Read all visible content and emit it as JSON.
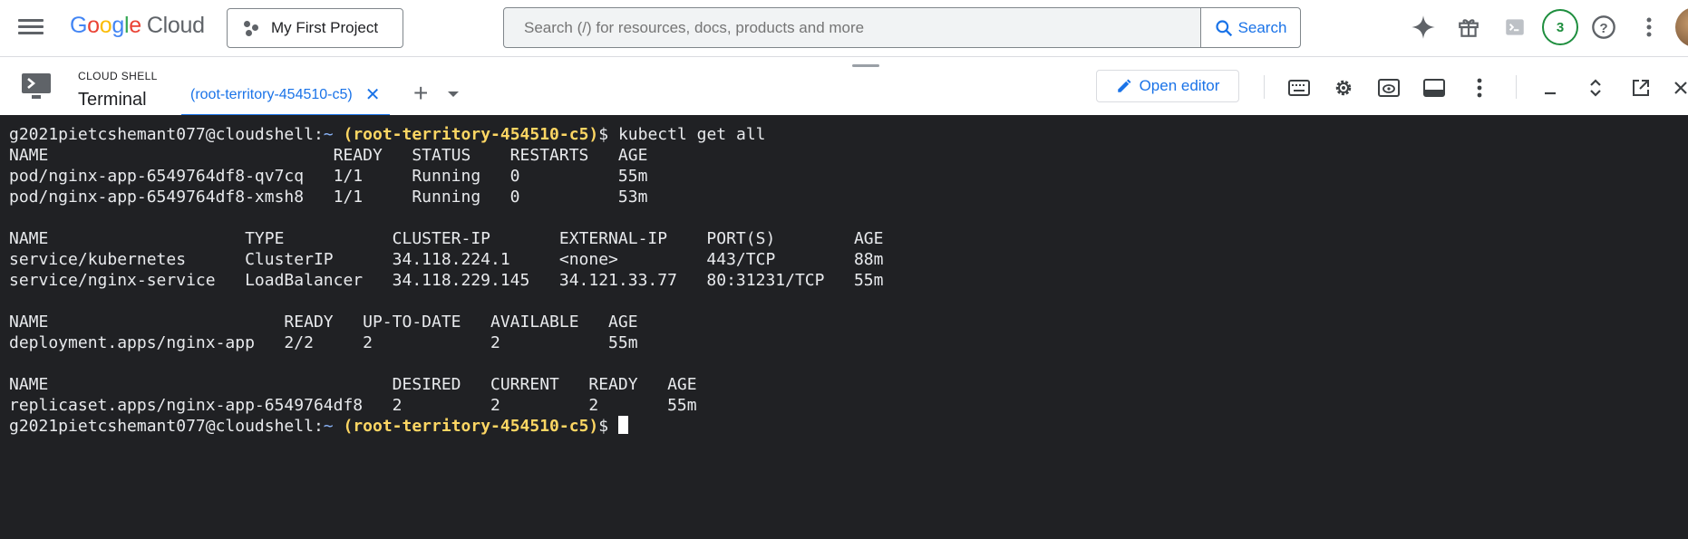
{
  "header": {
    "menu_icon": "hamburger-menu-icon",
    "logo": {
      "google": "Google",
      "cloud": "Cloud"
    },
    "project_label": "My First Project",
    "search": {
      "placeholder": "Search (/) for resources, docs, products and more",
      "button_label": "Search"
    },
    "notifications_count": "3",
    "icons": [
      "gemini-sparkle-icon",
      "gift-icon",
      "cloud-shell-icon",
      "help-icon",
      "more-vert-icon",
      "avatar"
    ]
  },
  "shell": {
    "caption": "CLOUD SHELL",
    "title": "Terminal",
    "tab_label": "(root-territory-454510-c5)",
    "open_editor_label": "Open editor"
  },
  "terminal": {
    "prompt_user": "g2021pietcshemant077@cloudshell",
    "prompt_path": "~",
    "prompt_project": "(root-territory-454510-c5)",
    "prompt_symbol": "$",
    "command": "kubectl get all",
    "output": [
      "NAME                             READY   STATUS    RESTARTS   AGE",
      "pod/nginx-app-6549764df8-qv7cq   1/1     Running   0          55m",
      "pod/nginx-app-6549764df8-xmsh8   1/1     Running   0          53m",
      "",
      "NAME                    TYPE           CLUSTER-IP       EXTERNAL-IP    PORT(S)        AGE",
      "service/kubernetes      ClusterIP      34.118.224.1     <none>         443/TCP        88m",
      "service/nginx-service   LoadBalancer   34.118.229.145   34.121.33.77   80:31231/TCP   55m",
      "",
      "NAME                        READY   UP-TO-DATE   AVAILABLE   AGE",
      "deployment.apps/nginx-app   2/2     2            2           55m",
      "",
      "NAME                                   DESIRED   CURRENT   READY   AGE",
      "replicaset.apps/nginx-app-6549764df8   2         2         2       55m"
    ]
  },
  "colors": {
    "terminal_bg": "#202124",
    "accent": "#1a73e8",
    "prompt_project": "#fdd663",
    "prompt_path": "#8ab4f8"
  }
}
